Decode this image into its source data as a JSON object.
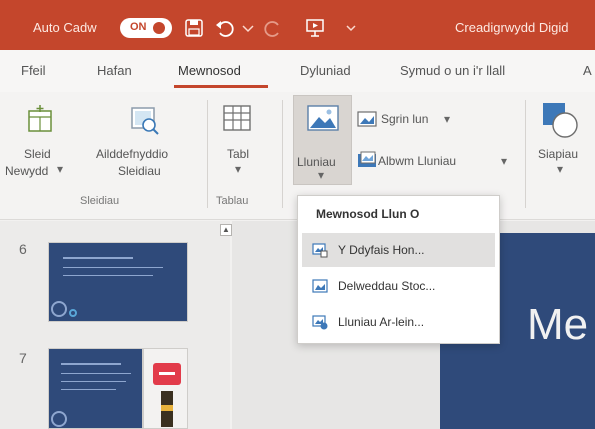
{
  "titlebar": {
    "autosave_label": "Auto Cadw",
    "toggle_label": "ON",
    "document_title": "Creadigrwydd Digid"
  },
  "tabs": [
    {
      "label": "Ffeil"
    },
    {
      "label": "Hafan"
    },
    {
      "label": "Mewnosod"
    },
    {
      "label": "Dyluniad"
    },
    {
      "label": "Symud o un i'r llall"
    },
    {
      "label": "A"
    }
  ],
  "ribbon": {
    "new_slide_label_1": "Sleid",
    "new_slide_label_2": "Newydd",
    "reuse_slides_label_1": "Ailddefnyddio",
    "reuse_slides_label_2": "Sleidiau",
    "slides_group": "Sleidiau",
    "table_label": "Tabl",
    "tables_group": "Tablau",
    "pictures_label": "Lluniau",
    "screenshot_label": "Sgrin lun",
    "photo_album_label": "Albwm Lluniau",
    "shapes_label": "Siapiau"
  },
  "dropdown": {
    "header": "Mewnosod Llun O",
    "items": [
      {
        "label": "Y Ddyfais Hon...",
        "icon": "device-icon"
      },
      {
        "label": "Delweddau Stoc...",
        "icon": "stock-images-icon"
      },
      {
        "label": "Lluniau Ar-lein...",
        "icon": "online-pictures-icon"
      }
    ]
  },
  "thumbnails": [
    {
      "number": "6"
    },
    {
      "number": "7"
    }
  ],
  "slide": {
    "title_partial": "Me"
  },
  "colors": {
    "accent": "#c4462c",
    "slide_background": "#2f4a7a"
  }
}
